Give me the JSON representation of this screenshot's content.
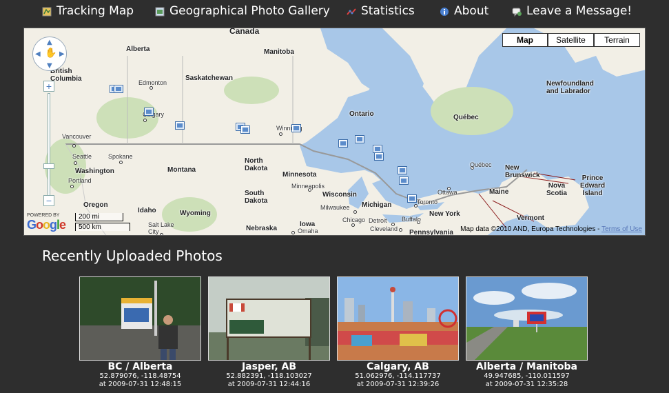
{
  "nav": [
    {
      "label": "Tracking Map",
      "icon": "map-icon",
      "color": "#e6c35a"
    },
    {
      "label": "Geographical Photo Gallery",
      "icon": "photo-gallery-icon",
      "color": "#6a9fd4"
    },
    {
      "label": "Statistics",
      "icon": "chart-icon",
      "color": "#e04040"
    },
    {
      "label": "About",
      "icon": "info-icon",
      "color": "#4a80d0"
    },
    {
      "label": "Leave a Message!",
      "icon": "message-icon",
      "color": "#5ba35b"
    }
  ],
  "map": {
    "type_buttons": [
      "Map",
      "Satellite",
      "Terrain"
    ],
    "active_type": "Map",
    "regions": [
      "Canada",
      "Alberta",
      "Manitoba",
      "British Columbia",
      "Saskatchewan",
      "Ontario",
      "Québec",
      "Newfoundland and Labrador",
      "North Dakota",
      "Montana",
      "Washington",
      "Oregon",
      "Idaho",
      "Wyoming",
      "South Dakota",
      "Minnesota",
      "Wisconsin",
      "Michigan",
      "Iowa",
      "Nebraska",
      "New York",
      "Pennsylvania",
      "Vermont",
      "Maine",
      "New Brunswick",
      "Nova Scotia",
      "Prince Edward Island"
    ],
    "cities": [
      "Edmonton",
      "Calgary",
      "Vancouver",
      "Seattle",
      "Spokane",
      "Portland",
      "Winnipeg",
      "Minneapolis",
      "Milwaukee",
      "Chicago",
      "Detroit",
      "Cleveland",
      "Buffalo",
      "Toronto",
      "Ottawa",
      "Québec",
      "Salt Lake City",
      "Omaha"
    ],
    "logo_powered": "POWERED BY",
    "logo_word": "Google",
    "scale_mi": "200 mi",
    "scale_km": "500 km",
    "attribution": "Map data ©2010 AND, Europa Technologies -",
    "terms": "Terms of Use"
  },
  "recent": {
    "title": "Recently Uploaded Photos",
    "photos": [
      {
        "title": "BC / Alberta",
        "coords": "52.879076, -118.48754",
        "time": "at 2009-07-31 12:48:15"
      },
      {
        "title": "Jasper, AB",
        "coords": "52.882391, -118.103027",
        "time": "at 2009-07-31 12:44:16"
      },
      {
        "title": "Calgary, AB",
        "coords": "51.062976, -114.117737",
        "time": "at 2009-07-31 12:39:26"
      },
      {
        "title": "Alberta / Manitoba",
        "coords": "49.947685, -110.011597",
        "time": "at 2009-07-31 12:35:28"
      }
    ]
  }
}
